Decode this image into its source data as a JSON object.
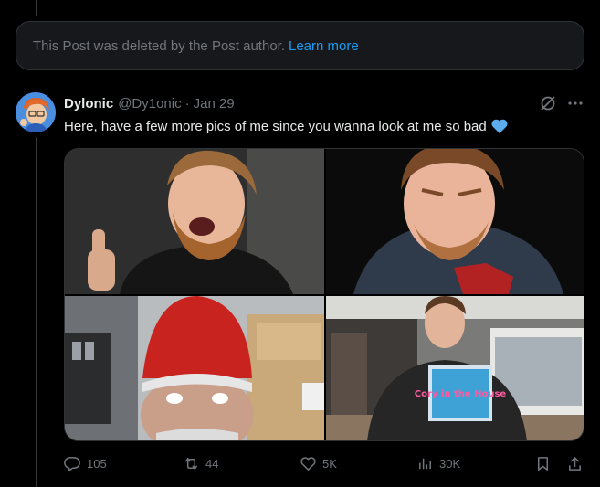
{
  "deleted_notice": {
    "text": "This Post was deleted by the Post author.",
    "link": "Learn more"
  },
  "post": {
    "display_name": "Dylonic",
    "handle": "@Dy1onic",
    "separator": "·",
    "time": "Jan 29",
    "text": "Here, have a few more pics of me since you wanna look at me so bad",
    "emoji": "blue-heart"
  },
  "media": [
    {
      "name": "photo-thumbs-up",
      "bg": "#3a3a3a"
    },
    {
      "name": "photo-red-shirt",
      "bg": "#0d0d0d"
    },
    {
      "name": "photo-gnome-hat",
      "bg": "#8a8f94"
    },
    {
      "name": "photo-game-store",
      "bg": "#6b6b6b",
      "game_box_text": "Cory in the House"
    }
  ],
  "actions": {
    "replies": "105",
    "reposts": "44",
    "likes": "5K",
    "views": "30K"
  },
  "colors": {
    "accent": "#1d9bf0",
    "muted": "#71767b",
    "text": "#e7e9ea",
    "border": "#2f3336"
  }
}
